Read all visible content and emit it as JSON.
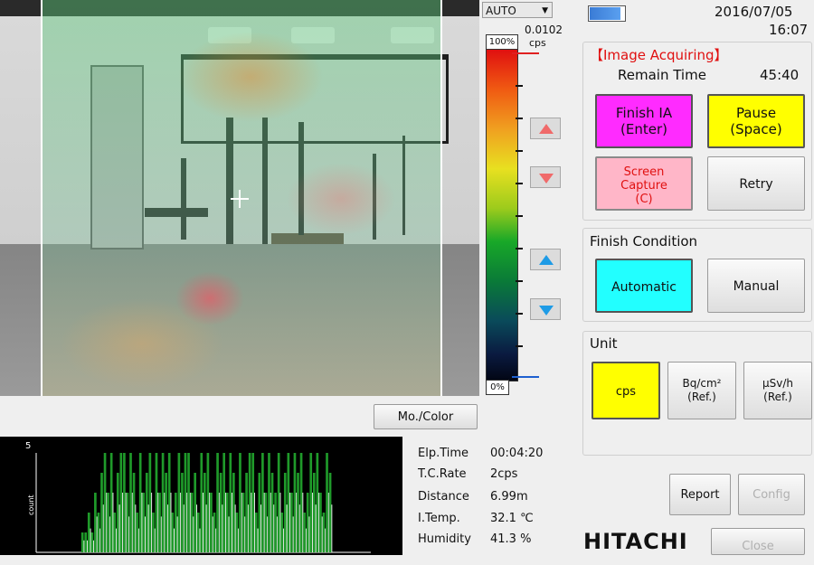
{
  "camera": {},
  "scale": {
    "mode": "AUTO",
    "top_value": "0.0102",
    "unit": "cps",
    "max_label": "100%",
    "min_label": "0%"
  },
  "scale_buttons": {
    "upper_up": "triangle-up-red-icon",
    "upper_down": "triangle-down-red-icon",
    "lower_up": "triangle-up-blue-icon",
    "lower_down": "triangle-down-blue-icon"
  },
  "mono_color_label": "Mo./Color",
  "count_chart": {
    "y_max_label": "5",
    "y_axis_label": "count"
  },
  "chart_data": {
    "type": "bar",
    "ylim": [
      0,
      5
    ],
    "values": [
      0,
      0,
      0,
      0,
      0,
      0,
      0,
      0,
      0,
      0,
      0,
      0,
      0,
      0,
      1,
      1,
      2,
      1,
      3,
      2,
      4,
      5,
      3,
      5,
      2,
      4,
      5,
      5,
      3,
      5,
      4,
      2,
      5,
      3,
      4,
      5,
      2,
      5,
      3,
      5,
      4,
      5,
      2,
      3,
      5,
      4,
      5,
      5,
      3,
      4,
      2,
      5,
      4,
      5,
      3,
      2,
      5,
      4,
      5,
      3,
      5,
      4,
      2,
      5,
      3,
      4,
      5,
      5,
      2,
      4,
      5,
      3,
      5,
      4,
      3,
      5,
      2,
      4,
      5,
      3,
      5,
      4,
      5,
      2,
      3,
      5,
      4,
      5,
      3,
      2,
      5,
      4,
      0,
      0,
      0,
      0,
      0,
      0,
      0,
      0,
      0,
      0,
      0,
      0
    ],
    "series_color": "#1f9a2a"
  },
  "readouts": {
    "elp_time": {
      "label": "Elp.Time",
      "value": "00:04:20"
    },
    "tc_rate": {
      "label": "T.C.Rate",
      "value": "2cps"
    },
    "distance": {
      "label": "Distance",
      "value": "6.99m"
    },
    "i_temp": {
      "label": "I.Temp.",
      "value": "32.1 ℃"
    },
    "humidity": {
      "label": "Humidity",
      "value": "41.3 %"
    }
  },
  "header": {
    "date": "2016/07/05",
    "time": "16:07",
    "battery_level": 0.9
  },
  "status": {
    "title": "【Image Acquiring】",
    "remain_label": "Remain Time",
    "remain_value": "45:40"
  },
  "actions": {
    "finish_line1": "Finish IA",
    "finish_line2": "(Enter)",
    "pause_line1": "Pause",
    "pause_line2": "(Space)",
    "capture_line1": "Screen",
    "capture_line2": "Capture",
    "capture_line3": "(C)",
    "retry": "Retry"
  },
  "finish_condition": {
    "title": "Finish Condition",
    "automatic": "Automatic",
    "manual": "Manual"
  },
  "unit": {
    "title": "Unit",
    "cps": "cps",
    "bq_line1": "Bq/cm²",
    "bq_line2": "(Ref.)",
    "usv_line1": "μSv/h",
    "usv_line2": "(Ref.)"
  },
  "footer": {
    "report": "Report",
    "config": "Config",
    "close": "Close",
    "brand": "HITACHI"
  },
  "colors": {
    "finish_btn": "#ff2bff",
    "pause_btn": "#ffff00",
    "capture_btn": "#ffb6c8",
    "automatic_btn": "#22ffff",
    "cps_btn": "#ffff00",
    "status_red": "#e01010"
  }
}
